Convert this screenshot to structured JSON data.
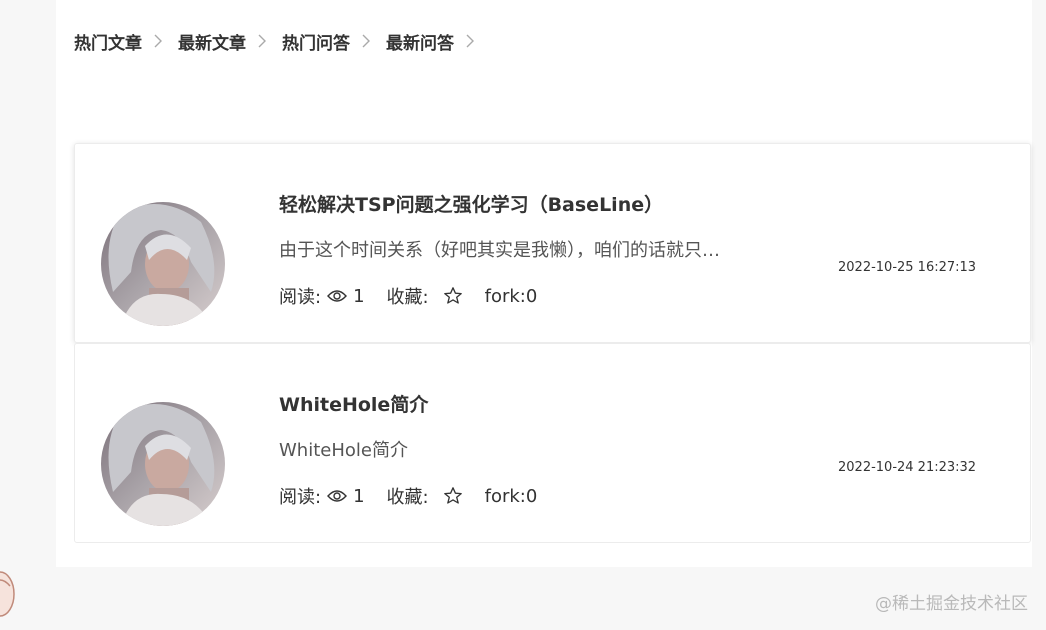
{
  "nav": {
    "items": [
      {
        "label": "热门文章"
      },
      {
        "label": "最新文章"
      },
      {
        "label": "热门问答"
      },
      {
        "label": "最新问答"
      }
    ]
  },
  "articles": [
    {
      "title": "轻松解决TSP问题之强化学习（BaseLine）",
      "summary": "由于这个时间关系（好吧其实是我懒），咱们的话就只…",
      "read_label": "阅读:",
      "read_count": "1",
      "fav_label": "收藏:",
      "fork": "fork:0",
      "date": "2022-10-25 16:27:13"
    },
    {
      "title": "WhiteHole简介",
      "summary": "WhiteHole简介",
      "read_label": "阅读:",
      "read_count": "1",
      "fav_label": "收藏:",
      "fork": "fork:0",
      "date": "2022-10-24 21:23:32"
    }
  ],
  "watermark": "@稀土掘金技术社区",
  "icons": {
    "nav_separator": "chevron-right-icon",
    "views": "eye-icon",
    "favorite": "star-outline-icon"
  }
}
